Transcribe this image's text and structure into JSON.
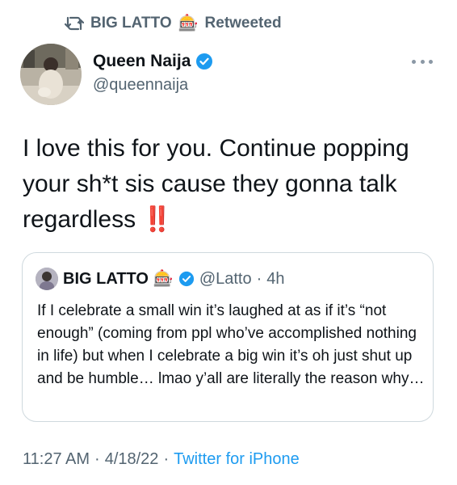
{
  "retweet_bar": {
    "icon": "retweet-icon",
    "user": "BIG LATTO",
    "emoji": "🎰",
    "label": "Retweeted"
  },
  "author": {
    "name": "Queen Naija",
    "handle": "@queennaija",
    "verified": true,
    "avatar": "avatar"
  },
  "tweet": {
    "text": "I love this for you. Continue popping your sh*t sis cause they gonna talk regardless ",
    "emphasis": "‼️"
  },
  "quote": {
    "name": "BIG LATTO",
    "emoji": "🎰",
    "verified": true,
    "handle": "@Latto",
    "separator": "·",
    "time": "4h",
    "text": "If I celebrate a small win it’s laughed at as if it’s “not enough” (coming from ppl who’ve accomplished nothing in life) but when I celebrate a big win it’s oh just shut up and be humble… lmao y’all are literally the reason why…"
  },
  "footer": {
    "time": "11:27 AM",
    "separator": "·",
    "date": "4/18/22",
    "source": "Twitter for iPhone"
  },
  "colors": {
    "verified": "#1d9bf0",
    "muted": "#536471",
    "link": "#1d9bf0",
    "border": "#cfd9de"
  }
}
